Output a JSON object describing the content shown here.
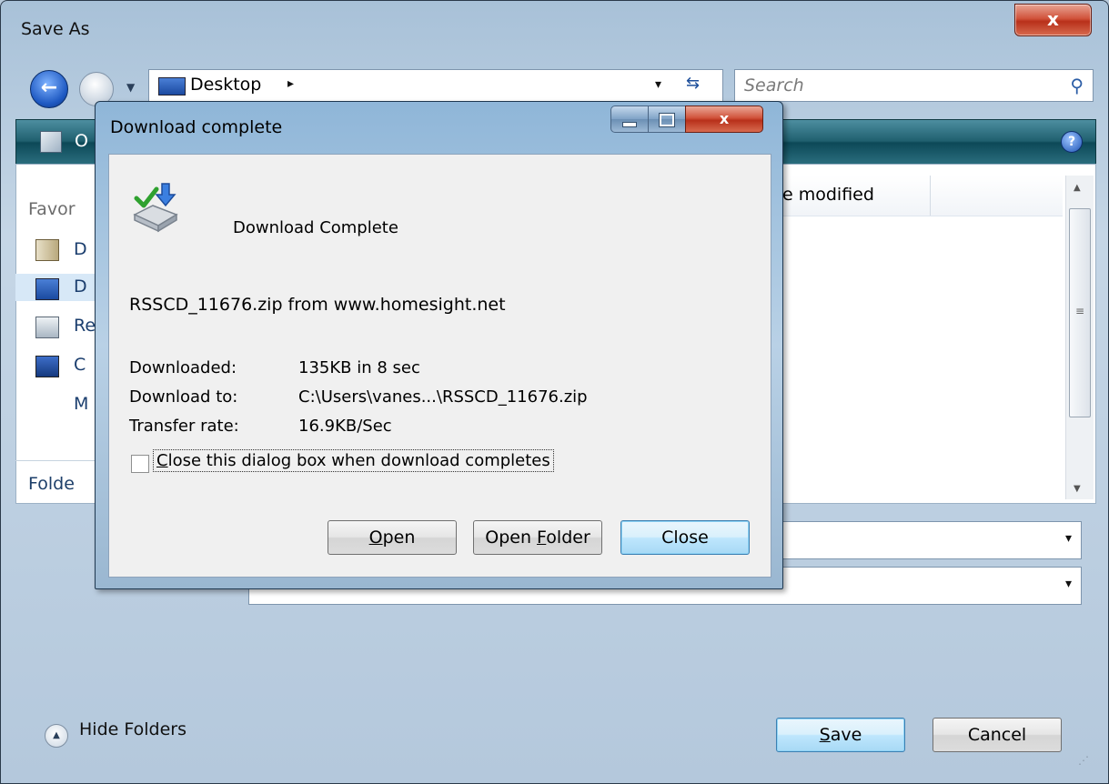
{
  "save_as": {
    "title": "Save As",
    "close_glyph": "x",
    "address": {
      "location": "Desktop",
      "arrow": "▸",
      "dropdown": "▾",
      "refresh": "⇆"
    },
    "search": {
      "placeholder": "Search"
    },
    "toolbar": {
      "first_button_partial": "O",
      "help": "?"
    },
    "favorites": {
      "heading_partial": "Favor",
      "items_partial": [
        "D",
        "D",
        "Re",
        "C",
        "M"
      ]
    },
    "folders_label_partial": "Folde",
    "file_list": {
      "column_header_partial": "e modified"
    },
    "file_name_dropdown": "▾",
    "save_as_type_dropdown": "▾",
    "hide_folders": "Hide Folders",
    "save_button": {
      "prefix": "",
      "accel": "S",
      "rest": "ave"
    },
    "cancel_button": "Cancel"
  },
  "download_dialog": {
    "title": "Download complete",
    "heading": "Download Complete",
    "source": "RSSCD_11676.zip from www.homesight.net",
    "downloaded_label": "Downloaded:",
    "downloaded_value": "135KB in 8 sec",
    "download_to_label": "Download to:",
    "download_to_value": "C:\\Users\\vanes...\\RSSCD_11676.zip",
    "transfer_rate_label": "Transfer rate:",
    "transfer_rate_value": "16.9KB/Sec",
    "close_when_done": {
      "checked": false,
      "accel": "C",
      "rest": "lose this dialog box when download completes"
    },
    "open_button": {
      "accel": "O",
      "rest": "pen"
    },
    "open_folder_button": {
      "prefix": "Open ",
      "accel": "F",
      "rest": "older"
    },
    "close_button": "Close",
    "close_glyph": "x"
  }
}
